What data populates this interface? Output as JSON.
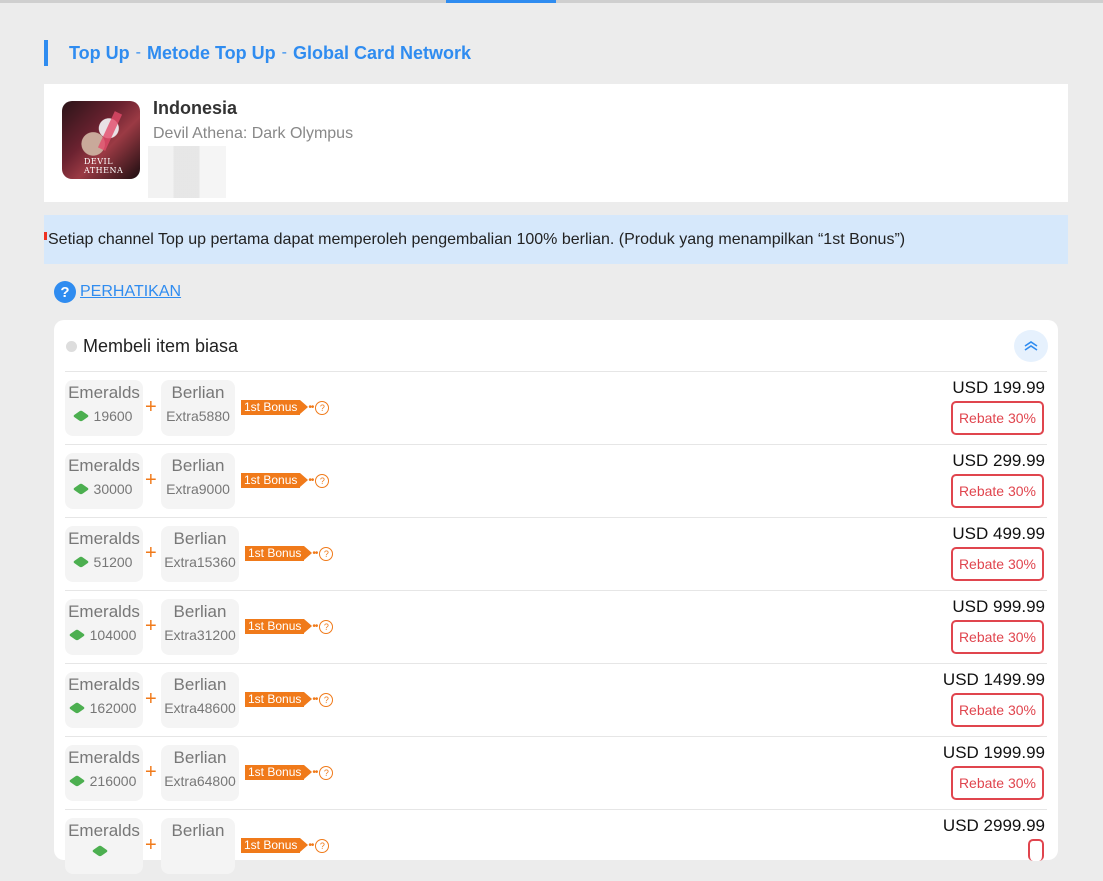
{
  "breadcrumb": {
    "part1": "Top Up",
    "sep1": "-",
    "part2": "Metode Top Up",
    "sep2": "-",
    "part3": "Global Card Network"
  },
  "game": {
    "country": "Indonesia",
    "name": "Devil Athena: Dark Olympus",
    "logo_text": "DEVIL ATHENA"
  },
  "notice": "Setiap channel Top up pertama dapat memperoleh pengembalian 100% berlian. (Produk yang menampilkan “1st Bonus”)",
  "help": {
    "icon": "?",
    "label": "PERHATIKAN"
  },
  "panel": {
    "title": "Membeli item biasa"
  },
  "products": [
    {
      "item1": "Emeralds",
      "amount1": "19600",
      "item2": "Berlian",
      "amount2": "Extra5880",
      "bonus": "1st Bonus",
      "price": "USD 199.99",
      "rebate": "Rebate 30%"
    },
    {
      "item1": "Emeralds",
      "amount1": "30000",
      "item2": "Berlian",
      "amount2": "Extra9000",
      "bonus": "1st Bonus",
      "price": "USD 299.99",
      "rebate": "Rebate 30%"
    },
    {
      "item1": "Emeralds",
      "amount1": "51200",
      "item2": "Berlian",
      "amount2": "Extra15360",
      "bonus": "1st Bonus",
      "price": "USD 499.99",
      "rebate": "Rebate 30%"
    },
    {
      "item1": "Emeralds",
      "amount1": "104000",
      "item2": "Berlian",
      "amount2": "Extra31200",
      "bonus": "1st Bonus",
      "price": "USD 999.99",
      "rebate": "Rebate 30%"
    },
    {
      "item1": "Emeralds",
      "amount1": "162000",
      "item2": "Berlian",
      "amount2": "Extra48600",
      "bonus": "1st Bonus",
      "price": "USD 1499.99",
      "rebate": "Rebate 30%"
    },
    {
      "item1": "Emeralds",
      "amount1": "216000",
      "item2": "Berlian",
      "amount2": "Extra64800",
      "bonus": "1st Bonus",
      "price": "USD 1999.99",
      "rebate": "Rebate 30%"
    },
    {
      "item1": "Emeralds",
      "amount1": "",
      "item2": "Berlian",
      "amount2": "",
      "bonus": "1st Bonus",
      "price": "USD 2999.99",
      "rebate": ""
    }
  ],
  "colors": {
    "accent": "#2f8cf0",
    "bonus": "#f07a1a",
    "rebate": "#e0454e",
    "notice_bg": "#d6e8fb"
  }
}
